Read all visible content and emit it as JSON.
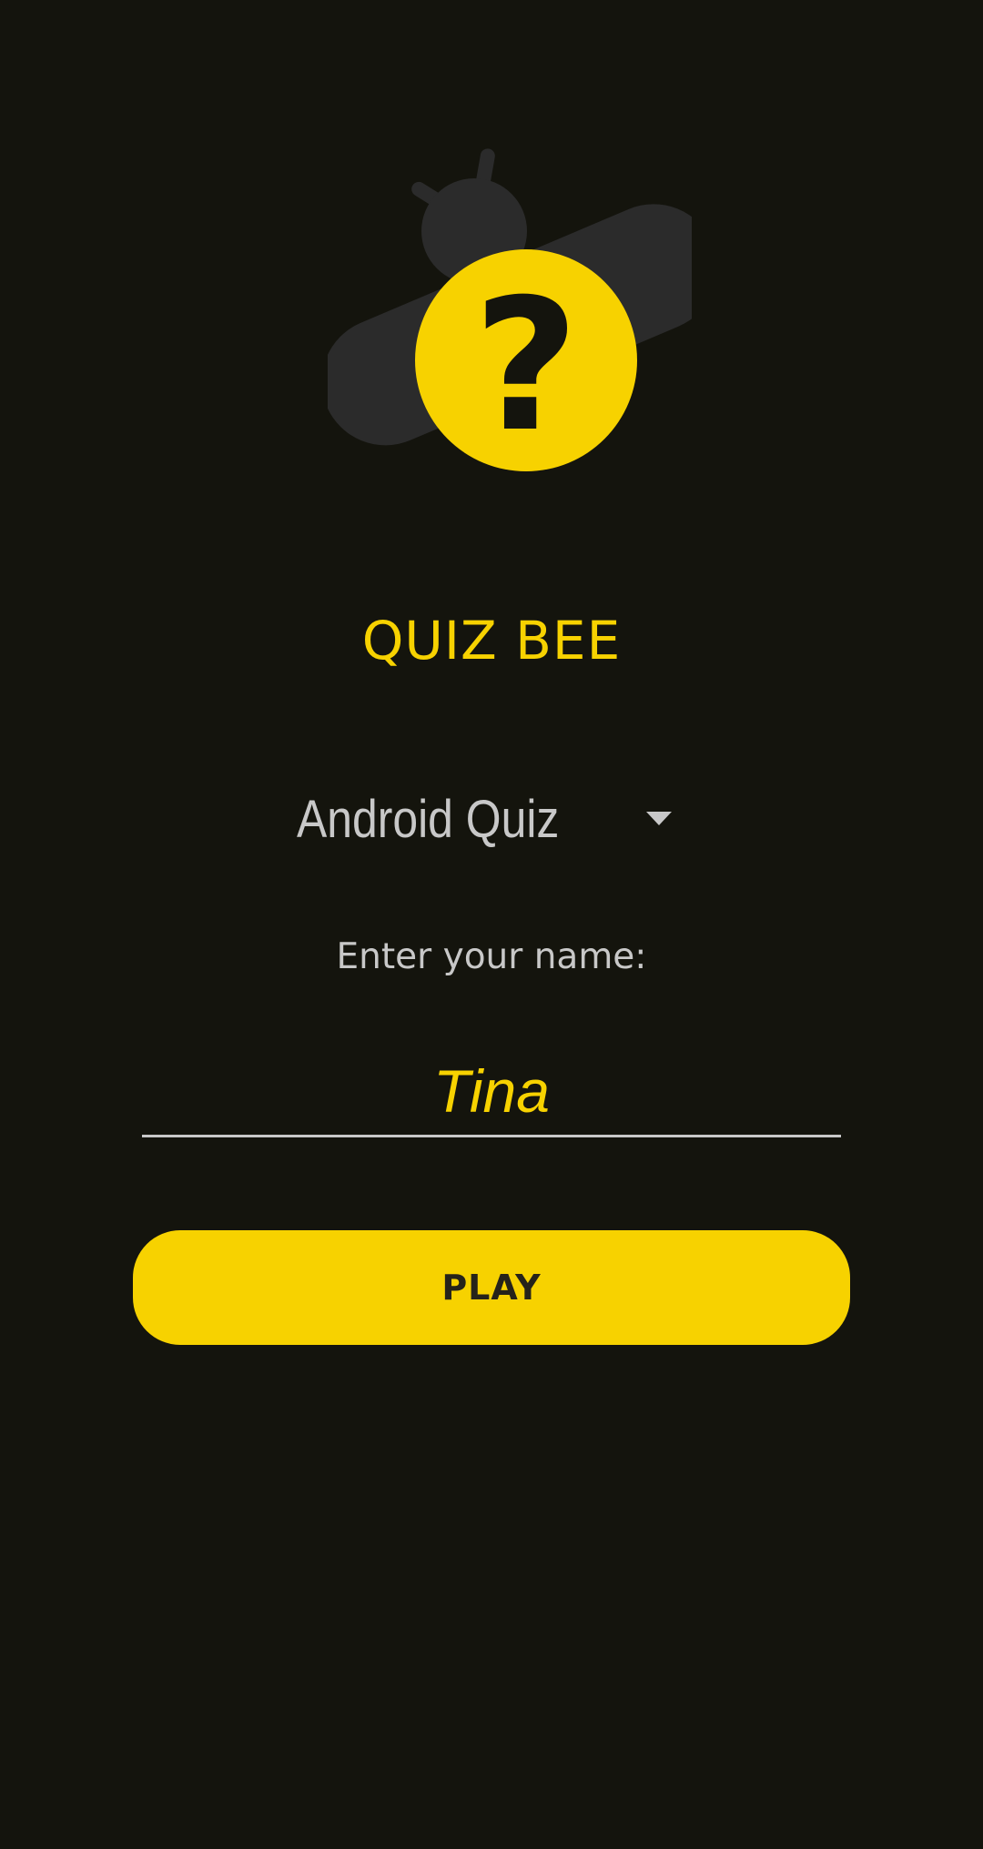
{
  "app": {
    "title": "QUIZ BEE",
    "logo_icon": "bee-question-icon",
    "accent_color": "#f7d200",
    "background_color": "#14140d"
  },
  "quiz_select": {
    "selected": "Android Quiz",
    "icon": "caret-down-icon"
  },
  "name_form": {
    "prompt": "Enter your name:",
    "value": "Tina"
  },
  "actions": {
    "play_label": "PLAY"
  }
}
